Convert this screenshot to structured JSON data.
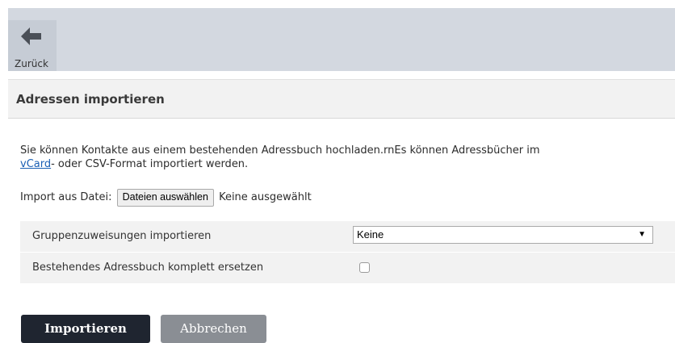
{
  "toolbar": {
    "back_label": "Zurück"
  },
  "panel": {
    "title": "Adressen importieren"
  },
  "description": {
    "line1": "Sie können Kontakte aus einem bestehenden Adressbuch hochladen.rnEs können Adressbücher im",
    "link": "vCard",
    "line2_rest": "- oder CSV-Format importiert werden."
  },
  "file_import": {
    "label": "Import aus Datei:",
    "button": "Dateien auswählen",
    "status": "Keine ausgewählt"
  },
  "options": {
    "group_label": "Gruppenzuweisungen importieren",
    "group_value": "Keine",
    "replace_label": "Bestehendes Adressbuch komplett ersetzen",
    "replace_checked": false
  },
  "actions": {
    "import": "Importieren",
    "cancel": "Abbrechen"
  },
  "colors": {
    "topbar": "#d3d8e0",
    "primary_button": "#1f2530",
    "secondary_button": "#8a8e94",
    "link": "#1a5fb4"
  }
}
